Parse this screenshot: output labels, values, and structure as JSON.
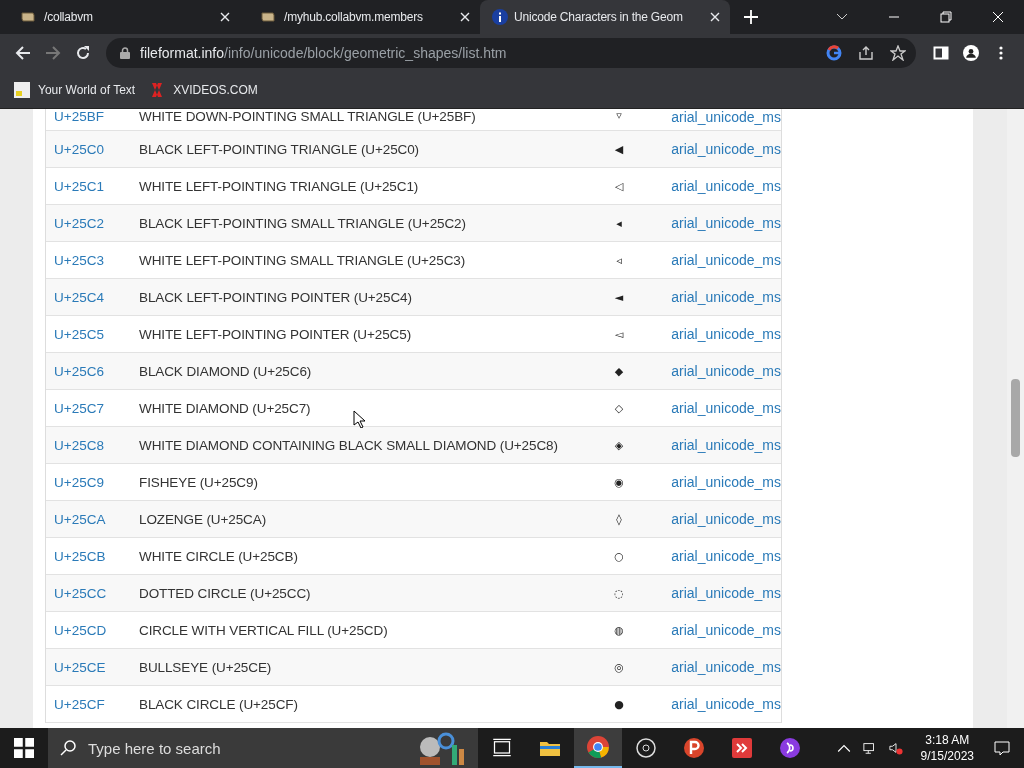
{
  "tabs": [
    {
      "title": "/collabvm",
      "selected": false
    },
    {
      "title": "/myhub.collabvm.members",
      "selected": false
    },
    {
      "title": "Unicode Characters in the Geom",
      "selected": true
    }
  ],
  "address_bar": {
    "domain": "fileformat.info",
    "path": "/info/unicode/block/geometric_shapes/list.htm"
  },
  "bookmarks": [
    {
      "label": "Your World of Text",
      "kind": "ywot"
    },
    {
      "label": "XVIDEOS.COM",
      "kind": "x"
    }
  ],
  "table": {
    "rows": [
      {
        "code": "U+25BF",
        "name": "WHITE DOWN-POINTING SMALL TRIANGLE (U+25BF)",
        "glyph": "▿",
        "font": "arial_unicode_ms"
      },
      {
        "code": "U+25C0",
        "name": "BLACK LEFT-POINTING TRIANGLE (U+25C0)",
        "glyph": "◀",
        "font": "arial_unicode_ms"
      },
      {
        "code": "U+25C1",
        "name": "WHITE LEFT-POINTING TRIANGLE (U+25C1)",
        "glyph": "◁",
        "font": "arial_unicode_ms"
      },
      {
        "code": "U+25C2",
        "name": "BLACK LEFT-POINTING SMALL TRIANGLE (U+25C2)",
        "glyph": "◂",
        "font": "arial_unicode_ms"
      },
      {
        "code": "U+25C3",
        "name": "WHITE LEFT-POINTING SMALL TRIANGLE (U+25C3)",
        "glyph": "◃",
        "font": "arial_unicode_ms"
      },
      {
        "code": "U+25C4",
        "name": "BLACK LEFT-POINTING POINTER (U+25C4)",
        "glyph": "◄",
        "font": "arial_unicode_ms"
      },
      {
        "code": "U+25C5",
        "name": "WHITE LEFT-POINTING POINTER (U+25C5)",
        "glyph": "◅",
        "font": "arial_unicode_ms"
      },
      {
        "code": "U+25C6",
        "name": "BLACK DIAMOND (U+25C6)",
        "glyph": "◆",
        "font": "arial_unicode_ms"
      },
      {
        "code": "U+25C7",
        "name": "WHITE DIAMOND (U+25C7)",
        "glyph": "◇",
        "font": "arial_unicode_ms"
      },
      {
        "code": "U+25C8",
        "name": "WHITE DIAMOND CONTAINING BLACK SMALL DIAMOND (U+25C8)",
        "glyph": "◈",
        "font": "arial_unicode_ms"
      },
      {
        "code": "U+25C9",
        "name": "FISHEYE (U+25C9)",
        "glyph": "◉",
        "font": "arial_unicode_ms"
      },
      {
        "code": "U+25CA",
        "name": "LOZENGE (U+25CA)",
        "glyph": "◊",
        "font": "arial_unicode_ms"
      },
      {
        "code": "U+25CB",
        "name": "WHITE CIRCLE (U+25CB)",
        "glyph": "○",
        "font": "arial_unicode_ms"
      },
      {
        "code": "U+25CC",
        "name": "DOTTED CIRCLE (U+25CC)",
        "glyph": "◌",
        "font": "arial_unicode_ms"
      },
      {
        "code": "U+25CD",
        "name": "CIRCLE WITH VERTICAL FILL (U+25CD)",
        "glyph": "◍",
        "font": "arial_unicode_ms"
      },
      {
        "code": "U+25CE",
        "name": "BULLSEYE (U+25CE)",
        "glyph": "◎",
        "font": "arial_unicode_ms"
      },
      {
        "code": "U+25CF",
        "name": "BLACK CIRCLE (U+25CF)",
        "glyph": "●",
        "font": "arial_unicode_ms"
      }
    ]
  },
  "taskbar": {
    "search_placeholder": "Type here to search",
    "time": "3:18 AM",
    "date": "9/15/2023"
  }
}
